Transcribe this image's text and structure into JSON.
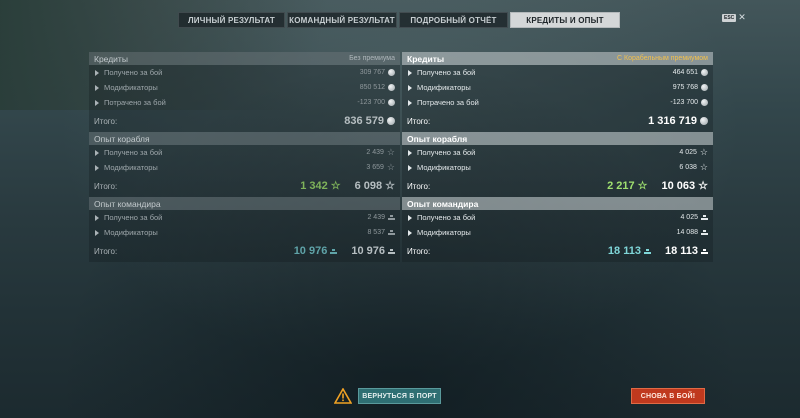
{
  "tabs": [
    {
      "label": "ЛИЧНЫЙ РЕЗУЛЬТАТ"
    },
    {
      "label": "КОМАНДНЫЙ РЕЗУЛЬТАТ"
    },
    {
      "label": "ПОДРОБНЫЙ ОТЧЁТ"
    },
    {
      "label": "КРЕДИТЫ И ОПЫТ"
    }
  ],
  "active_tab": "КРЕДИТЫ И ОПЫТ",
  "esc_label": "ESC",
  "left": {
    "credits": {
      "title": "Кредиты",
      "tag": "Без премиума",
      "rows": [
        {
          "label": "Получено за бой",
          "value": "309 767"
        },
        {
          "label": "Модификаторы",
          "value": "850 512"
        },
        {
          "label": "Потрачено за бой",
          "value": "-123 700"
        }
      ],
      "total_label": "Итого:",
      "total": "836 579"
    },
    "ship_xp": {
      "title": "Опыт корабля",
      "rows": [
        {
          "label": "Получено за бой",
          "value": "2 439"
        },
        {
          "label": "Модификаторы",
          "value": "3 659"
        }
      ],
      "total_label": "Итого:",
      "free": "1 342",
      "total": "6 098"
    },
    "cmd_xp": {
      "title": "Опыт командира",
      "rows": [
        {
          "label": "Получено за бой",
          "value": "2 439"
        },
        {
          "label": "Модификаторы",
          "value": "8 537"
        }
      ],
      "total_label": "Итого:",
      "elite": "10 976",
      "total": "10 976"
    }
  },
  "right": {
    "credits": {
      "title": "Кредиты",
      "tag": "С Корабельным премиумом",
      "rows": [
        {
          "label": "Получено за бой",
          "value": "464 651"
        },
        {
          "label": "Модификаторы",
          "value": "975 768"
        },
        {
          "label": "Потрачено за бой",
          "value": "-123 700"
        }
      ],
      "total_label": "Итого:",
      "total": "1 316 719"
    },
    "ship_xp": {
      "title": "Опыт корабля",
      "rows": [
        {
          "label": "Получено за бой",
          "value": "4 025"
        },
        {
          "label": "Модификаторы",
          "value": "6 038"
        }
      ],
      "total_label": "Итого:",
      "free": "2 217",
      "total": "10 063"
    },
    "cmd_xp": {
      "title": "Опыт командира",
      "rows": [
        {
          "label": "Получено за бой",
          "value": "4 025"
        },
        {
          "label": "Модификаторы",
          "value": "14 088"
        }
      ],
      "total_label": "Итого:",
      "elite": "18 113",
      "total": "18 113"
    }
  },
  "buttons": {
    "port": "ВЕРНУТЬСЯ В ПОРТ",
    "battle": "СНОВА В БОЙ!"
  },
  "icons": {
    "credits": "silver-coin-icon",
    "ship_xp": "star-icon",
    "cmd_xp": "commander-xp-icon",
    "warning": "warning-triangle-icon"
  },
  "colors": {
    "premium_tag": "#f2c04c",
    "free_xp": "#9fe06f",
    "elite_xp": "#7fd6d8",
    "battle_button": "#c0391e",
    "port_button": "#2f6f73"
  }
}
